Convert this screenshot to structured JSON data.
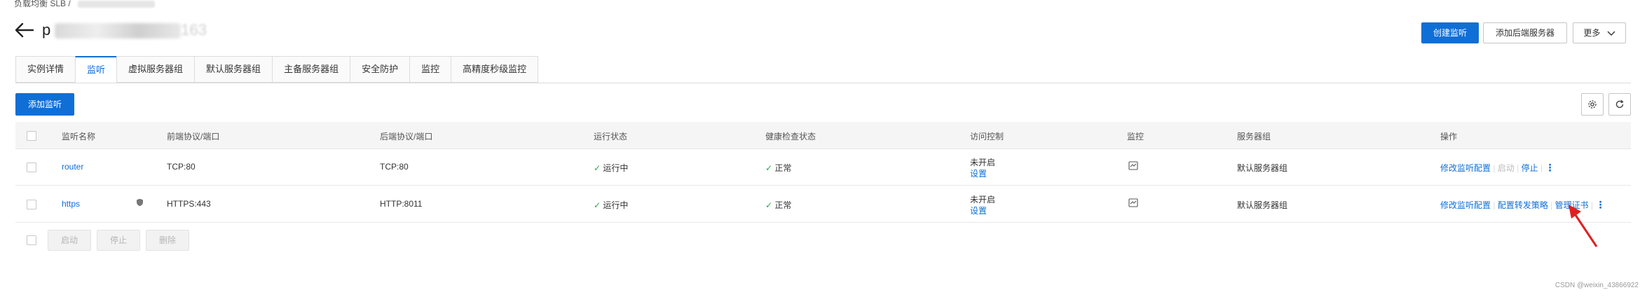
{
  "breadcrumb": {
    "text": "负载均衡 SLB  /"
  },
  "header": {
    "title_visible_prefix": "p",
    "title_visible_suffix": "163",
    "create_listener_label": "创建监听",
    "add_backend_label": "添加后端服务器",
    "more_label": "更多"
  },
  "tabs": [
    {
      "label": "实例详情",
      "active": false
    },
    {
      "label": "监听",
      "active": true
    },
    {
      "label": "虚拟服务器组",
      "active": false
    },
    {
      "label": "默认服务器组",
      "active": false
    },
    {
      "label": "主备服务器组",
      "active": false
    },
    {
      "label": "安全防护",
      "active": false
    },
    {
      "label": "监控",
      "active": false
    },
    {
      "label": "高精度秒级监控",
      "active": false
    }
  ],
  "toolbar": {
    "add_listener_label": "添加监听",
    "settings_icon": "gear-icon",
    "refresh_icon": "refresh-icon"
  },
  "table": {
    "columns": {
      "name": "监听名称",
      "frontend": "前端协议/端口",
      "backend": "后端协议/端口",
      "status": "运行状态",
      "health": "健康检查状态",
      "access": "访问控制",
      "monitor": "监控",
      "server_group": "服务器组",
      "actions": "操作"
    },
    "rows": [
      {
        "name": "router",
        "frontend": "TCP:80",
        "backend": "TCP:80",
        "status": "运行中",
        "health": "正常",
        "access_state": "未开启",
        "access_link": "设置",
        "server_group": "默认服务器组",
        "action_edit": "修改监听配置",
        "action_start": "启动",
        "action_stop": "停止"
      },
      {
        "name": "https",
        "frontend": "HTTPS:443",
        "backend": "HTTP:8011",
        "status": "运行中",
        "health": "正常",
        "access_state": "未开启",
        "access_link": "设置",
        "server_group": "默认服务器组",
        "action_edit": "修改监听配置",
        "action_forward": "配置转发策略",
        "action_cert": "管理证书"
      }
    ]
  },
  "bulk": {
    "start_label": "启动",
    "stop_label": "停止",
    "delete_label": "删除"
  },
  "watermark": "CSDN @weixin_43866922",
  "colors": {
    "primary": "#0f6fd6",
    "success": "#2ea44f",
    "annotation_arrow": "#e02020"
  }
}
